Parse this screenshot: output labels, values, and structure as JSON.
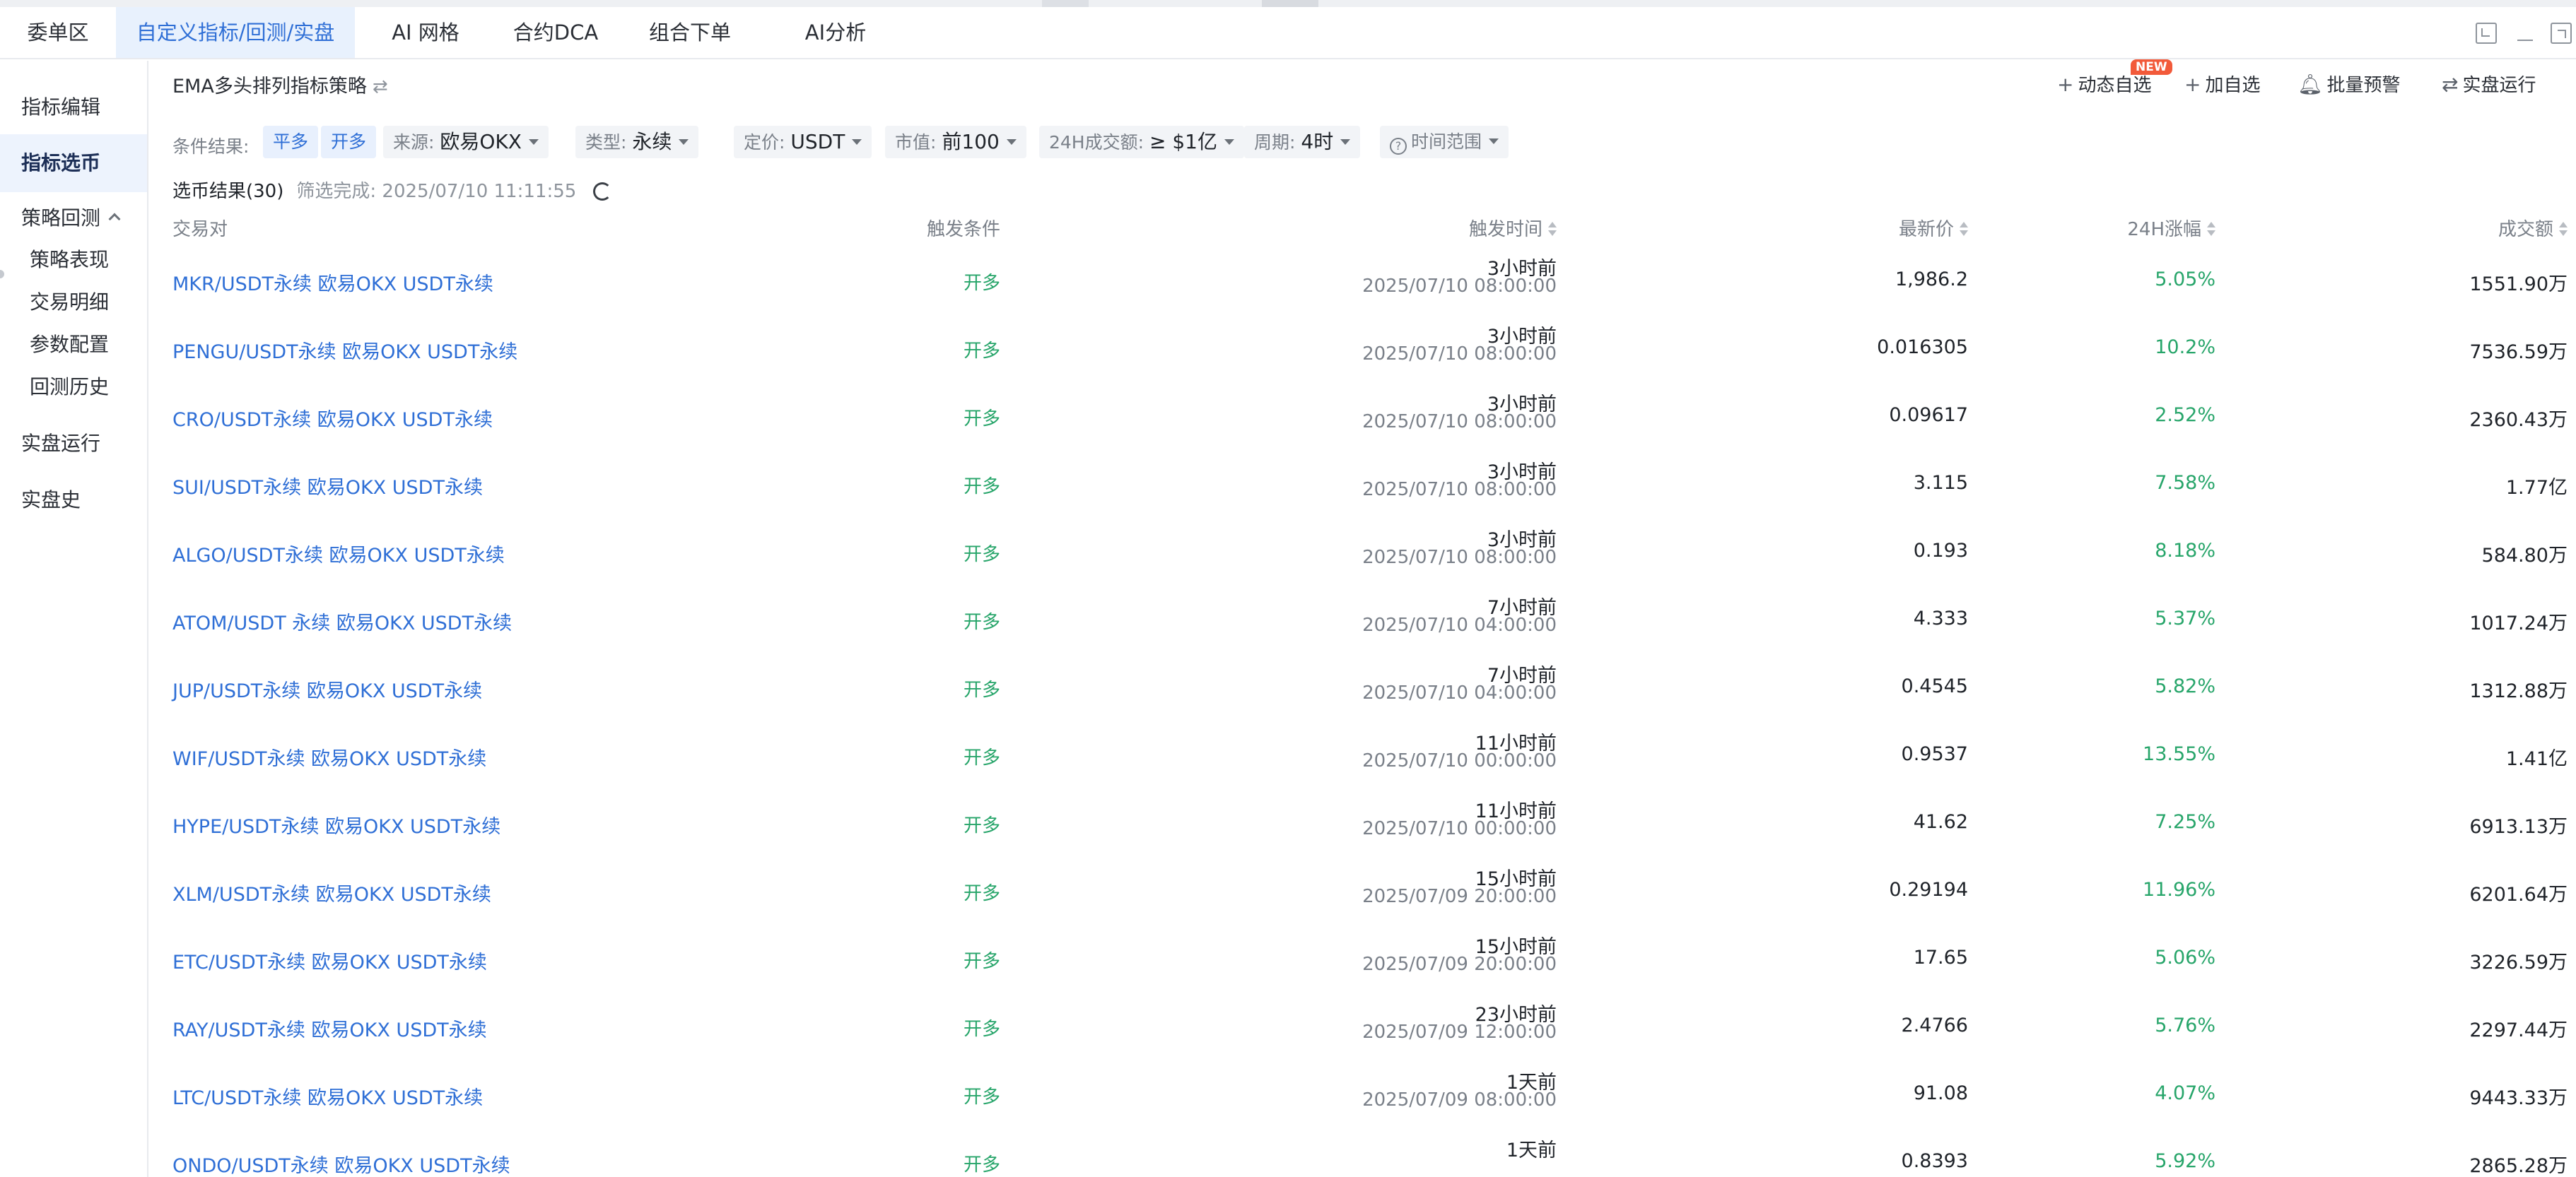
{
  "tabs": [
    "委单区",
    "自定义指标/回测/实盘",
    "AI 网格",
    "合约DCA",
    "组合下单",
    "AI分析"
  ],
  "sidebar": {
    "items": [
      "指标编辑",
      "指标选币",
      "策略回测"
    ],
    "sub_items": [
      "策略表现",
      "交易明细",
      "参数配置",
      "回测历史"
    ],
    "bottom_items": [
      "实盘运行",
      "实盘史"
    ]
  },
  "strategy_title": "EMA多头排列指标策略",
  "actions": {
    "dynamic_watch": "动态自选",
    "new_badge": "NEW",
    "add_watch": "加自选",
    "batch_alert": "批量预警",
    "live_run": "实盘运行"
  },
  "filters": {
    "result_label": "条件结果:",
    "result_chip1": "平多",
    "result_chip2": "开多",
    "source_key": "来源:",
    "source_value": "欧易OKX",
    "type_key": "类型:",
    "type_value": "永续",
    "quote_key": "定价:",
    "quote_value": "USDT",
    "mcap_key": "市值:",
    "mcap_value": "前100",
    "vol_key": "24H成交额:",
    "vol_value": "≥ $1亿",
    "period_key": "周期:",
    "period_value": "4时",
    "time_range": "时间范围"
  },
  "summary": {
    "title": "选币结果(30)",
    "done": "筛选完成: 2025/07/10 11:11:55"
  },
  "columns": [
    "交易对",
    "触发条件",
    "触发时间",
    "最新价",
    "24H涨幅",
    "成交额"
  ],
  "rows": [
    {
      "pair": "MKR/USDT永续 欧易OKX USDT永续",
      "cond": "开多",
      "ago": "3小时前",
      "time": "2025/07/10 08:00:00",
      "price": "1,986.2",
      "chg": "5.05%",
      "vol": "1551.90万"
    },
    {
      "pair": "PENGU/USDT永续 欧易OKX USDT永续",
      "cond": "开多",
      "ago": "3小时前",
      "time": "2025/07/10 08:00:00",
      "price": "0.016305",
      "chg": "10.2%",
      "vol": "7536.59万"
    },
    {
      "pair": "CRO/USDT永续 欧易OKX USDT永续",
      "cond": "开多",
      "ago": "3小时前",
      "time": "2025/07/10 08:00:00",
      "price": "0.09617",
      "chg": "2.52%",
      "vol": "2360.43万"
    },
    {
      "pair": "SUI/USDT永续 欧易OKX USDT永续",
      "cond": "开多",
      "ago": "3小时前",
      "time": "2025/07/10 08:00:00",
      "price": "3.115",
      "chg": "7.58%",
      "vol": "1.77亿"
    },
    {
      "pair": "ALGO/USDT永续 欧易OKX USDT永续",
      "cond": "开多",
      "ago": "3小时前",
      "time": "2025/07/10 08:00:00",
      "price": "0.193",
      "chg": "8.18%",
      "vol": "584.80万"
    },
    {
      "pair": "ATOM/USDT 永续 欧易OKX USDT永续",
      "cond": "开多",
      "ago": "7小时前",
      "time": "2025/07/10 04:00:00",
      "price": "4.333",
      "chg": "5.37%",
      "vol": "1017.24万"
    },
    {
      "pair": "JUP/USDT永续 欧易OKX USDT永续",
      "cond": "开多",
      "ago": "7小时前",
      "time": "2025/07/10 04:00:00",
      "price": "0.4545",
      "chg": "5.82%",
      "vol": "1312.88万"
    },
    {
      "pair": "WIF/USDT永续 欧易OKX USDT永续",
      "cond": "开多",
      "ago": "11小时前",
      "time": "2025/07/10 00:00:00",
      "price": "0.9537",
      "chg": "13.55%",
      "vol": "1.41亿"
    },
    {
      "pair": "HYPE/USDT永续 欧易OKX USDT永续",
      "cond": "开多",
      "ago": "11小时前",
      "time": "2025/07/10 00:00:00",
      "price": "41.62",
      "chg": "7.25%",
      "vol": "6913.13万"
    },
    {
      "pair": "XLM/USDT永续 欧易OKX USDT永续",
      "cond": "开多",
      "ago": "15小时前",
      "time": "2025/07/09 20:00:00",
      "price": "0.29194",
      "chg": "11.96%",
      "vol": "6201.64万"
    },
    {
      "pair": "ETC/USDT永续 欧易OKX USDT永续",
      "cond": "开多",
      "ago": "15小时前",
      "time": "2025/07/09 20:00:00",
      "price": "17.65",
      "chg": "5.06%",
      "vol": "3226.59万"
    },
    {
      "pair": "RAY/USDT永续 欧易OKX USDT永续",
      "cond": "开多",
      "ago": "23小时前",
      "time": "2025/07/09 12:00:00",
      "price": "2.4766",
      "chg": "5.76%",
      "vol": "2297.44万"
    },
    {
      "pair": "LTC/USDT永续 欧易OKX USDT永续",
      "cond": "开多",
      "ago": "1天前",
      "time": "2025/07/09 08:00:00",
      "price": "91.08",
      "chg": "4.07%",
      "vol": "9443.33万"
    },
    {
      "pair": "ONDO/USDT永续 欧易OKX USDT永续",
      "cond": "开多",
      "ago": "1天前",
      "time": "",
      "price": "0.8393",
      "chg": "5.92%",
      "vol": "2865.28万"
    }
  ]
}
